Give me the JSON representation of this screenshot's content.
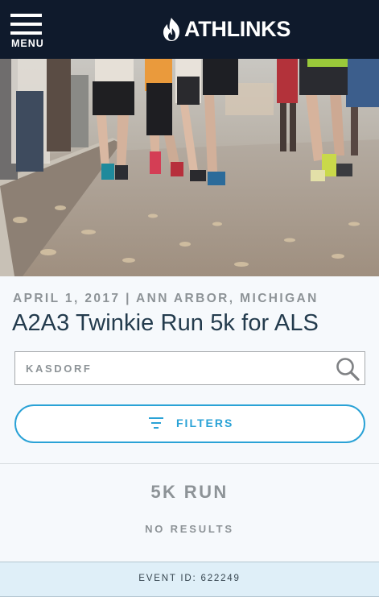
{
  "header": {
    "menu_label": "MENU",
    "logo_text": "ATHLINKS",
    "background_color": "#0f1a2c"
  },
  "hero": {
    "image_description_icon": "runners-photo"
  },
  "event": {
    "date_location": "APRIL 1, 2017 | ANN ARBOR, MICHIGAN",
    "title": "A2A3 Twinkie Run 5k for ALS"
  },
  "search": {
    "placeholder": "KASDORF",
    "icon": "search-icon"
  },
  "filters": {
    "label": "FILTERS",
    "icon": "filter-icon",
    "accent_color": "#2aa2d6"
  },
  "results": {
    "race_name": "5K RUN",
    "status": "NO RESULTS"
  },
  "footer": {
    "event_id": "EVENT ID: 622249"
  }
}
